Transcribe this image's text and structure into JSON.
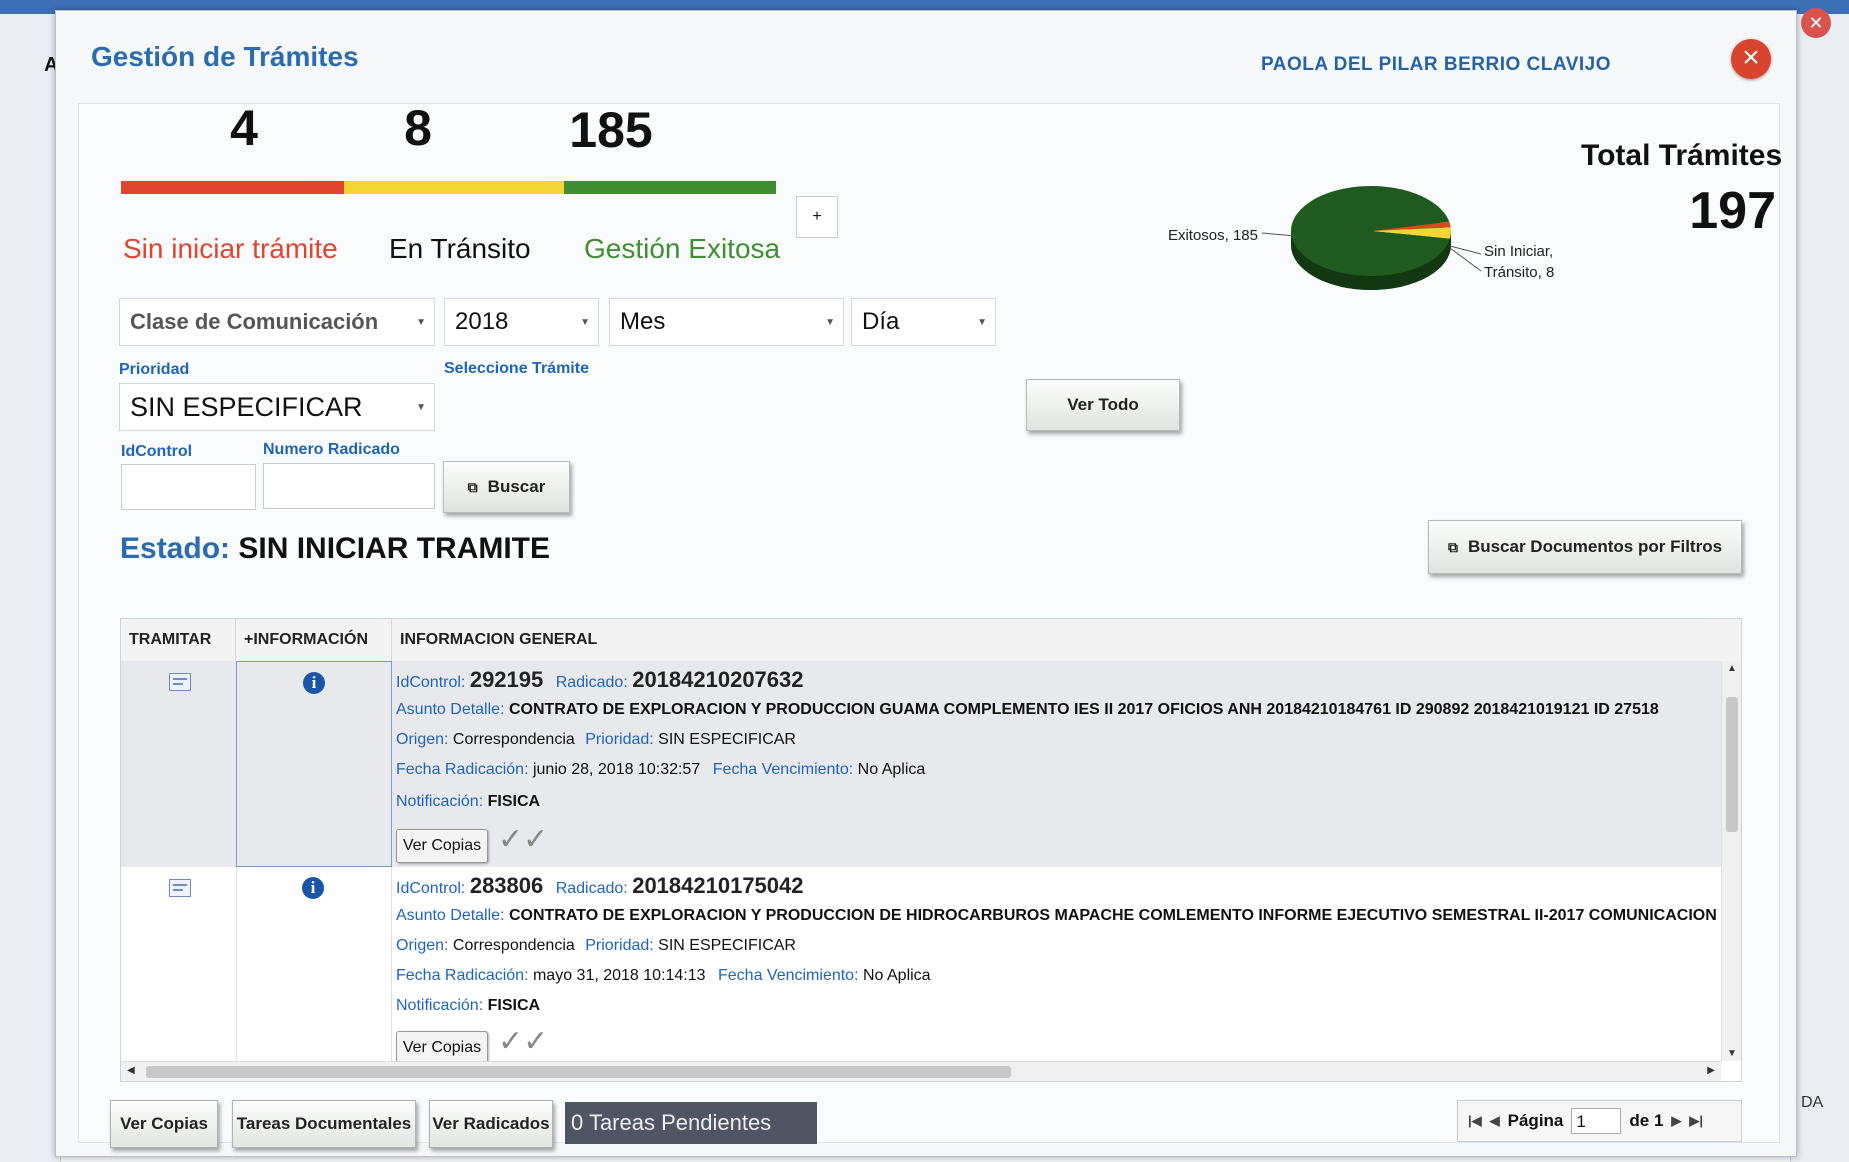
{
  "background": {
    "left_letter": "A",
    "right_text": "DA"
  },
  "modal": {
    "title": "Gestión de Trámites",
    "user": "PAOLA DEL PILAR BERRIO CLAVIJO"
  },
  "stats": {
    "sin_iniciar": {
      "value": "4",
      "label": "Sin iniciar trámite",
      "color": "#e0452e"
    },
    "en_transito": {
      "value": "8",
      "label": "En Tránsito",
      "color": "#f2d635"
    },
    "exitosa": {
      "value": "185",
      "label": "Gestión Exitosa",
      "color": "#3f8f32"
    },
    "plus": "+"
  },
  "total": {
    "label": "Total Trámites",
    "value": "197"
  },
  "chart_data": {
    "type": "pie",
    "categories": [
      "Exitosos",
      "Sin Iniciar",
      "Tránsito"
    ],
    "values": [
      185,
      4,
      8
    ],
    "colors": [
      "#1f5a1f",
      "#d94a1a",
      "#f2d635"
    ],
    "labels": [
      "Exitosos, 185",
      "Sin Iniciar, 4",
      "Tránsito, 8"
    ]
  },
  "filters": {
    "clase": "Clase de Comunicación",
    "anio": "2018",
    "mes": "Mes",
    "dia": "Día",
    "prioridad_label": "Prioridad",
    "prioridad_value": "SIN ESPECIFICAR",
    "seleccione_label": "Seleccione Trámite",
    "idcontrol_label": "IdControl",
    "radicado_label": "Numero Radicado",
    "buscar": "Buscar",
    "ver_todo": "Ver Todo",
    "buscar_filtros": "Buscar Documentos por Filtros"
  },
  "estado": {
    "key": "Estado:",
    "value": "SIN INICIAR TRAMITE"
  },
  "grid": {
    "headers": [
      "TRAMITAR",
      "+INFORMACIÓN",
      "INFORMACION GENERAL"
    ],
    "k_idcontrol": "IdControl:",
    "k_radicado": "Radicado:",
    "k_asunto": "Asunto Detalle:",
    "k_origen": "Origen:",
    "k_prioridad": "Prioridad:",
    "k_fecha_rad": "Fecha Radicación:",
    "k_fecha_ven": "Fecha Vencimiento:",
    "k_notif": "Notificación:",
    "ver_copias": "Ver Copias",
    "rows": [
      {
        "idcontrol": "292195",
        "radicado": "20184210207632",
        "asunto": "CONTRATO DE EXPLORACION Y PRODUCCION GUAMA COMPLEMENTO IES II 2017 OFICIOS ANH 20184210184761 ID 290892 2018421019121 ID 27518",
        "origen": "Correspondencia",
        "prioridad": "SIN ESPECIFICAR",
        "fecha_rad": "junio 28, 2018 10:32:57",
        "fecha_ven": "No Aplica",
        "notificacion": "FISICA"
      },
      {
        "idcontrol": "283806",
        "radicado": "20184210175042",
        "asunto": "CONTRATO DE EXPLORACION Y PRODUCCION DE HIDROCARBUROS MAPACHE COMLEMENTO INFORME EJECUTIVO SEMESTRAL II-2017 COMUNICACION",
        "origen": "Correspondencia",
        "prioridad": "SIN ESPECIFICAR",
        "fecha_rad": "mayo 31, 2018 10:14:13",
        "fecha_ven": "No Aplica",
        "notificacion": "FISICA"
      }
    ]
  },
  "footer": {
    "ver_copias": "Ver Copias",
    "tareas": "Tareas Documentales",
    "ver_radicados": "Ver Radicados",
    "pendientes": "0 Tareas Pendientes",
    "pagina_label": "Página",
    "pagina_value": "1",
    "de_label": "de 1"
  }
}
